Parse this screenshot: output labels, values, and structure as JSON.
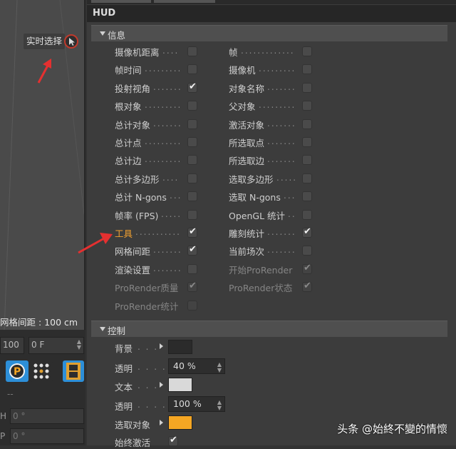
{
  "viewport": {
    "realtime_select_label": "实时选择",
    "grid_spacing_readout": "网格间距 : 100 cm"
  },
  "left_toolbar": {
    "frame_field": "100",
    "frame_field2": "0 F",
    "h_label": "H",
    "h_value": "0 °",
    "p_label": "P",
    "p_value": "0 °",
    "dash_text": "--"
  },
  "hud": {
    "title": "HUD",
    "info_section": "信息",
    "info_rows": [
      {
        "left": {
          "label": "摄像机距离",
          "checked": false
        },
        "right": {
          "label": "帧",
          "checked": false
        }
      },
      {
        "left": {
          "label": "帧时间",
          "checked": false
        },
        "right": {
          "label": "摄像机",
          "checked": false
        }
      },
      {
        "left": {
          "label": "投射视角",
          "checked": true
        },
        "right": {
          "label": "对象名称",
          "checked": false
        }
      },
      {
        "left": {
          "label": "根对象",
          "checked": false
        },
        "right": {
          "label": "父对象",
          "checked": false
        }
      },
      {
        "left": {
          "label": "总计对象",
          "checked": false
        },
        "right": {
          "label": "激活对象",
          "checked": false
        }
      },
      {
        "left": {
          "label": "总计点",
          "checked": false
        },
        "right": {
          "label": "所选取点",
          "checked": false
        }
      },
      {
        "left": {
          "label": "总计边",
          "checked": false
        },
        "right": {
          "label": "所选取边",
          "checked": false
        }
      },
      {
        "left": {
          "label": "总计多边形",
          "checked": false
        },
        "right": {
          "label": "选取多边形",
          "checked": false
        }
      },
      {
        "left": {
          "label": "总计 N-gons",
          "checked": false
        },
        "right": {
          "label": "选取 N-gons",
          "checked": false
        }
      },
      {
        "left": {
          "label": "帧率 (FPS)",
          "checked": false
        },
        "right": {
          "label": "OpenGL 统计",
          "checked": false
        }
      },
      {
        "left": {
          "label": "工具",
          "checked": true,
          "highlight": true
        },
        "right": {
          "label": "雕刻统计",
          "checked": true
        }
      },
      {
        "left": {
          "label": "网格间距",
          "checked": true
        },
        "right": {
          "label": "当前场次",
          "checked": false
        }
      },
      {
        "left": {
          "label": "渲染设置",
          "checked": false
        },
        "right": {
          "label": "开始ProRender",
          "checked": true,
          "disabled": true
        }
      },
      {
        "left": {
          "label": "ProRender质量",
          "checked": true,
          "disabled": true
        },
        "right": {
          "label": "ProRender状态",
          "checked": true,
          "disabled": true
        }
      },
      {
        "left": {
          "label": "ProRender统计",
          "checked": false,
          "disabled": true
        }
      }
    ],
    "control_section": "控制",
    "controls": {
      "background_label": "背景",
      "background_color": "#2b2b2b",
      "bg_opacity_label": "透明",
      "bg_opacity_value": "40 %",
      "text_label": "文本",
      "text_color": "#d9d9d9",
      "text_opacity_label": "透明",
      "text_opacity_value": "100 %",
      "selected_label": "选取对象",
      "selected_color": "#f5a623",
      "always_active_label": "始终激活",
      "always_active_checked": true
    }
  },
  "watermark": "头条 @始終不變的情懷",
  "colors": {
    "highlight_orange": "#f0a030",
    "annotation_red": "#e53030"
  }
}
